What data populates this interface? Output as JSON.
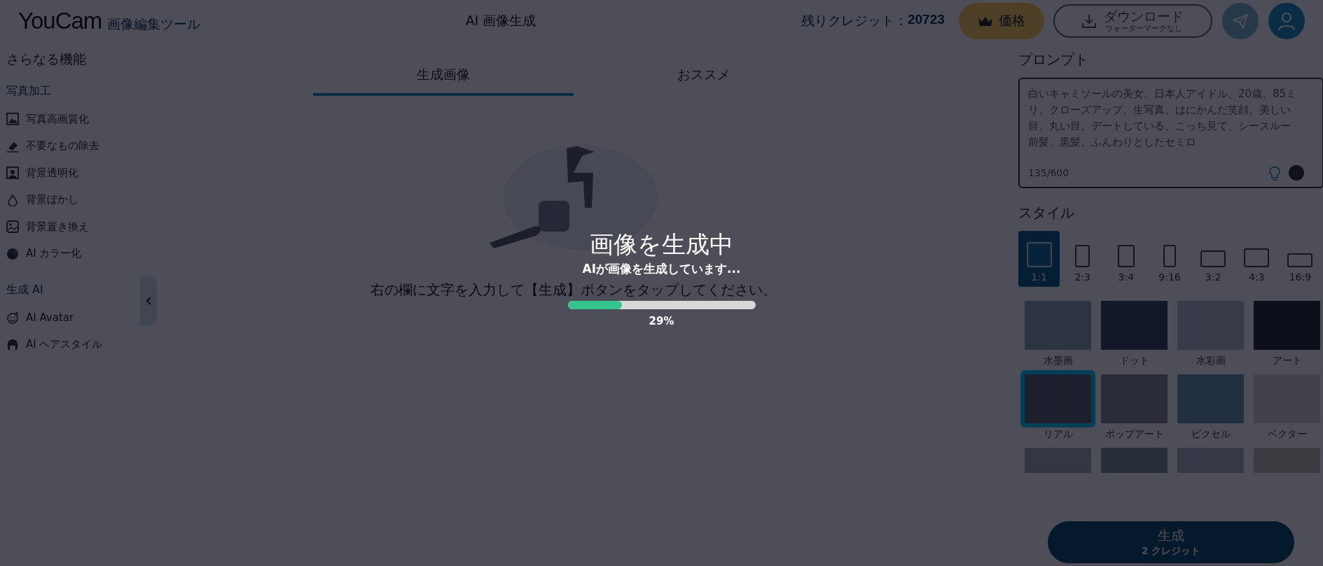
{
  "header": {
    "logo": "YouCam",
    "logo_sub": "画像編集ツール",
    "title": "AI 画像生成",
    "credits_label": "残りクレジット：",
    "credits_value": "20723",
    "price_button": "価格",
    "download_button": "ダウンロード",
    "download_sub": "ウォーターマークなし"
  },
  "sidebar": {
    "heading": "さらなる機能",
    "sections": [
      {
        "title": "写真加工",
        "items": [
          {
            "label": "写真高画質化",
            "kind": "enhance"
          },
          {
            "label": "不要なもの除去",
            "kind": "eraser"
          },
          {
            "label": "背景透明化",
            "kind": "cutout"
          },
          {
            "label": "背景ぼかし",
            "kind": "blur"
          },
          {
            "label": "背景置き換え",
            "kind": "replace"
          },
          {
            "label": "AI カラー化",
            "kind": "color"
          }
        ]
      },
      {
        "title": "生成 AI",
        "items": [
          {
            "label": "AI Avatar",
            "kind": "avatar"
          },
          {
            "label": "AI ヘアスタイル",
            "kind": "hair"
          }
        ]
      }
    ]
  },
  "tabs": [
    {
      "label": "生成画像",
      "selected": true
    },
    {
      "label": "おススメ",
      "selected": false
    }
  ],
  "empty_hint": "右の欄に文字を入力して【生成】ボタンをタップしてください。",
  "progress_dialog": {
    "title": "画像を生成中",
    "message": "AIが画像を生成しています...",
    "level": 0.29,
    "reading": "29%"
  },
  "prompt": {
    "heading": "プロンプト",
    "value": "白いキャミソールの美女、日本人アイドル、20歳、85ミリ、クローズアップ、生写真、はにかんだ笑顔、美しい目、丸い目、デートしている、こっち見て、シースルー前髪、黒髪、ふんわりとしたセミロ",
    "counter": "135/600"
  },
  "style": {
    "heading": "スタイル",
    "ratios": [
      {
        "label": "1:1",
        "selected": true
      },
      {
        "label": "2:3",
        "selected": false
      },
      {
        "label": "3:4",
        "selected": false
      },
      {
        "label": "9:16",
        "selected": false
      },
      {
        "label": "3:2",
        "selected": false
      },
      {
        "label": "4:3",
        "selected": false
      },
      {
        "label": "16:9",
        "selected": false
      }
    ],
    "presets": [
      {
        "label": "水墨画",
        "selected": false
      },
      {
        "label": "ドット",
        "selected": false
      },
      {
        "label": "水彩画",
        "selected": false
      },
      {
        "label": "アート",
        "selected": false
      },
      {
        "label": "リアル",
        "selected": true
      },
      {
        "label": "ポップアート",
        "selected": false
      },
      {
        "label": "ピクセル",
        "selected": false
      },
      {
        "label": "ベクター",
        "selected": false
      },
      {
        "selected": false
      },
      {
        "selected": false
      },
      {
        "selected": false
      },
      {
        "selected": false
      }
    ]
  },
  "generate_button": {
    "label": "生成",
    "sub": "2 クレジット"
  }
}
